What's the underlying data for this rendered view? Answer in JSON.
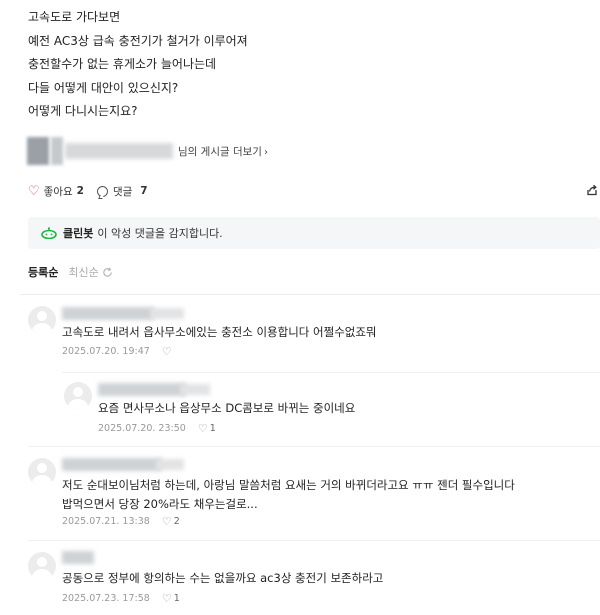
{
  "post": {
    "lines": [
      "고속도로 가다보면",
      "예전 AC3상 급속 충전기가 철거가 이루어져",
      "충전할수가 없는 휴게소가 늘어나는데",
      "다들 어떻게 대안이 있으신지?",
      "어떻게 다니시는지요?"
    ]
  },
  "author": {
    "more_label": "님의 게시글 더보기"
  },
  "actions": {
    "like_label": "좋아요",
    "like_count": "2",
    "comment_label": "댓글",
    "comment_count": "7"
  },
  "cleanbot": {
    "name": "클린봇",
    "message": "이 악성 댓글을 감지합니다."
  },
  "sort": {
    "tabs": [
      "등록순",
      "최신순"
    ],
    "active": "등록순"
  },
  "comments": [
    {
      "text": "고속도로 내려서 읍사무소에있는 충전소 이용합니다 어쩔수없죠뭐",
      "date": "2025.07.20. 19:47",
      "likes": "",
      "reply": false
    },
    {
      "text": "요즘 면사무소나 읍상무소 DC콤보로 바뀌는 중이네요",
      "date": "2025.07.20. 23:50",
      "likes": "1",
      "reply": true
    },
    {
      "text_lines": [
        "저도 순대보이님처럼 하는데, 아랑님 말씀처럼 요새는 거의 바뀌더라고요 ㅠㅠ 젠더 필수입니다",
        "밥먹으면서 당장 20%라도 채우는걸로..."
      ],
      "date": "2025.07.21. 13:38",
      "likes": "2",
      "reply": false
    },
    {
      "text": "공동으로 정부에 항의하는 수는 없을까요 ac3상 충전기 보존하라고",
      "date": "2025.07.23. 17:58",
      "likes": "1",
      "reply": false
    }
  ],
  "colors": {
    "heart": "#e0404a",
    "cleanbot_green": "#1fb53b",
    "cleanbot_bg": "#f5f6f7"
  },
  "icons": {
    "like": "heart-outline-icon",
    "comment": "speech-bubble-icon",
    "share": "share-icon",
    "cleanbot": "cleanbot-robot-icon",
    "refresh": "refresh-icon",
    "comment_like": "heart-outline-icon",
    "more": "chevron-right-icon"
  }
}
